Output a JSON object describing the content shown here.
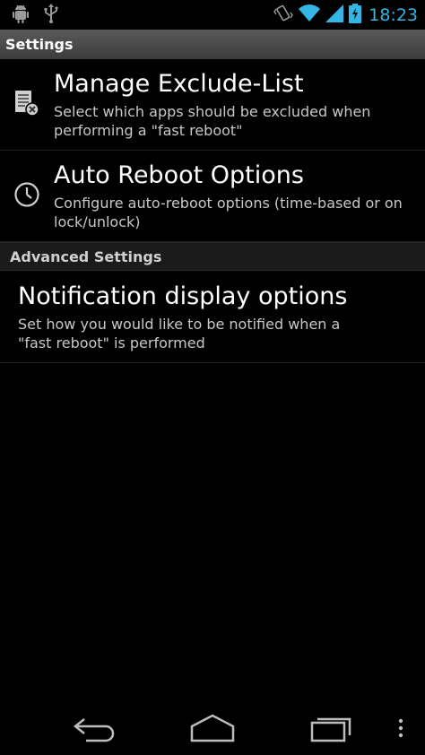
{
  "status_bar": {
    "time": "18:23",
    "time_color": "#33b5e5",
    "left_icons": [
      "android-debug-icon",
      "usb-icon"
    ],
    "right_icons": [
      "vibrate-icon",
      "wifi-icon",
      "signal-icon",
      "battery-charging-icon"
    ]
  },
  "title_bar": {
    "title": "Settings"
  },
  "preferences": [
    {
      "icon": "exclude-list-icon",
      "title": "Manage Exclude-List",
      "summary": "Select which apps should be excluded when performing a \"fast reboot\""
    },
    {
      "icon": "clock-icon",
      "title": "Auto Reboot Options",
      "summary": "Configure auto-reboot options (time-based or on lock/unlock)"
    }
  ],
  "category": {
    "label": "Advanced Settings"
  },
  "advanced_preferences": [
    {
      "title": "Notification display options",
      "summary": "Set how you would like to be notified when a \"fast reboot\" is performed"
    }
  ],
  "nav_bar": {
    "buttons": [
      "back-icon",
      "home-icon",
      "recent-apps-icon",
      "overflow-menu-icon"
    ]
  }
}
